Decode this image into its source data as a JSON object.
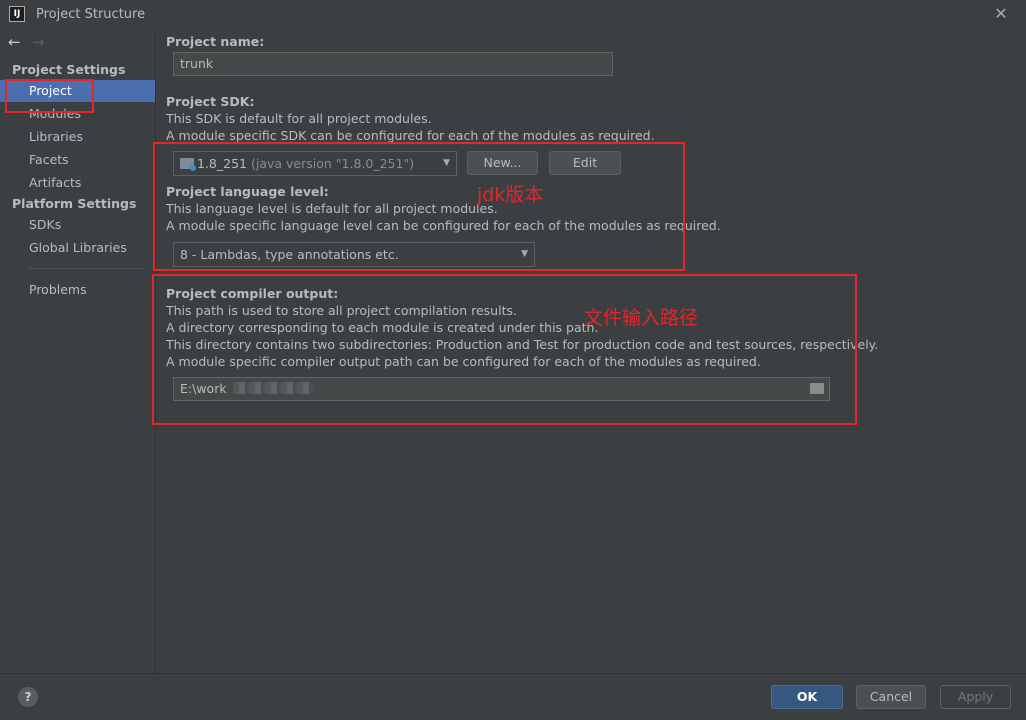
{
  "window": {
    "title": "Project Structure",
    "logo": "IJ"
  },
  "sidebar": {
    "project_settings_header": "Project Settings",
    "project_settings_items": [
      {
        "label": "Project"
      },
      {
        "label": "Modules"
      },
      {
        "label": "Libraries"
      },
      {
        "label": "Facets"
      },
      {
        "label": "Artifacts"
      }
    ],
    "platform_settings_header": "Platform Settings",
    "platform_settings_items": [
      {
        "label": "SDKs"
      },
      {
        "label": "Global Libraries"
      }
    ],
    "problems": "Problems"
  },
  "project_name": {
    "label": "Project name:",
    "value": "trunk"
  },
  "project_sdk": {
    "label": "Project SDK:",
    "desc1": "This SDK is default for all project modules.",
    "desc2": "A module specific SDK can be configured for each of the modules as required.",
    "selected_name": "1.8_251",
    "selected_detail": "(java version \"1.8.0_251\")",
    "new_button": "New...",
    "edit_button": "Edit"
  },
  "language_level": {
    "label": "Project language level:",
    "desc1": "This language level is default for all project modules.",
    "desc2": "A module specific language level can be configured for each of the modules as required.",
    "selected": "8 - Lambdas, type annotations etc."
  },
  "compiler_output": {
    "label": "Project compiler output:",
    "desc1": "This path is used to store all project compilation results.",
    "desc2": "A directory corresponding to each module is created under this path.",
    "desc3": "This directory contains two subdirectories: Production and Test for production code and test sources, respectively.",
    "desc4": "A module specific compiler output path can be configured for each of the modules as required.",
    "path": "E:\\work"
  },
  "annotations": {
    "jdk": "jdk版本",
    "output": "文件输入路径"
  },
  "footer": {
    "help": "?",
    "ok": "OK",
    "cancel": "Cancel",
    "apply": "Apply"
  },
  "colors": {
    "accent": "#4b6eaf",
    "annotation": "#e3262b",
    "ok_button": "#365880"
  }
}
